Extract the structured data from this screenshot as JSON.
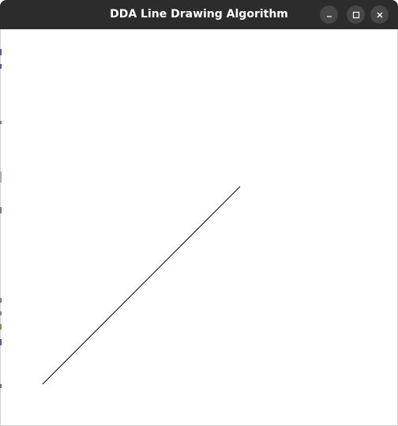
{
  "window": {
    "title": "DDA Line Drawing Algorithm"
  },
  "controls": {
    "minimize_icon": "minimize-icon",
    "maximize_icon": "maximize-icon",
    "close_icon": "close-icon"
  },
  "canvas": {
    "background": "#ffffff",
    "line_color": "#000000"
  },
  "colors": {
    "titlebar": "#2c2c2c",
    "button_bg": "#474747",
    "title_text": "#ffffff"
  }
}
